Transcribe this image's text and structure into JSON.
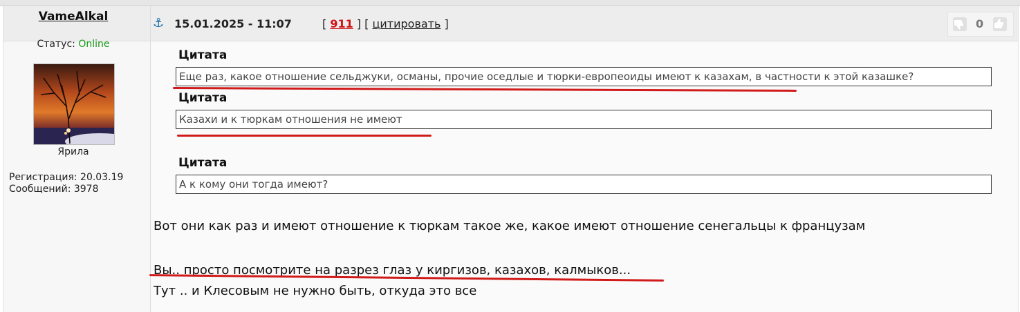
{
  "author": {
    "username": "VameAlkal",
    "status_label": "Статус: ",
    "status_value": "Online",
    "rank": "Ярила",
    "registration": "Регистрация: 20.03.19",
    "messages": "Сообщений: 3978"
  },
  "post": {
    "datetime": "15.01.2025 - 11:07",
    "post_number": "911",
    "quote_link": "цитировать",
    "rating": "0"
  },
  "quotes": [
    {
      "title": "Цитата",
      "text": "Еще раз, какое отношение сельджуки, османы, прочие оседлые и тюрки-европеоиды имеют к казахам, в частности к этой казашке?"
    },
    {
      "title": "Цитата",
      "text": "Казахи и к тюркам отношения не имеют"
    },
    {
      "title": "Цитата",
      "text": "А к кому они тогда имеют?"
    }
  ],
  "body": [
    "Вот они как раз и имеют отношение к тюркам такое же, какое имеют отношение сенегальцы к французам",
    "Вы.. просто посмотрите на разрез глаз у киргизов, казахов, калмыков...",
    "Тут .. и Клесовым не нужно быть, откуда это все"
  ],
  "colors": {
    "online": "#1a9a1a",
    "post_number": "#cc1111",
    "annotation": "#d11a1a",
    "anchor": "#1d6fa8"
  },
  "icons": [
    "anchor-icon",
    "thumb-down-icon",
    "thumb-up-icon"
  ]
}
